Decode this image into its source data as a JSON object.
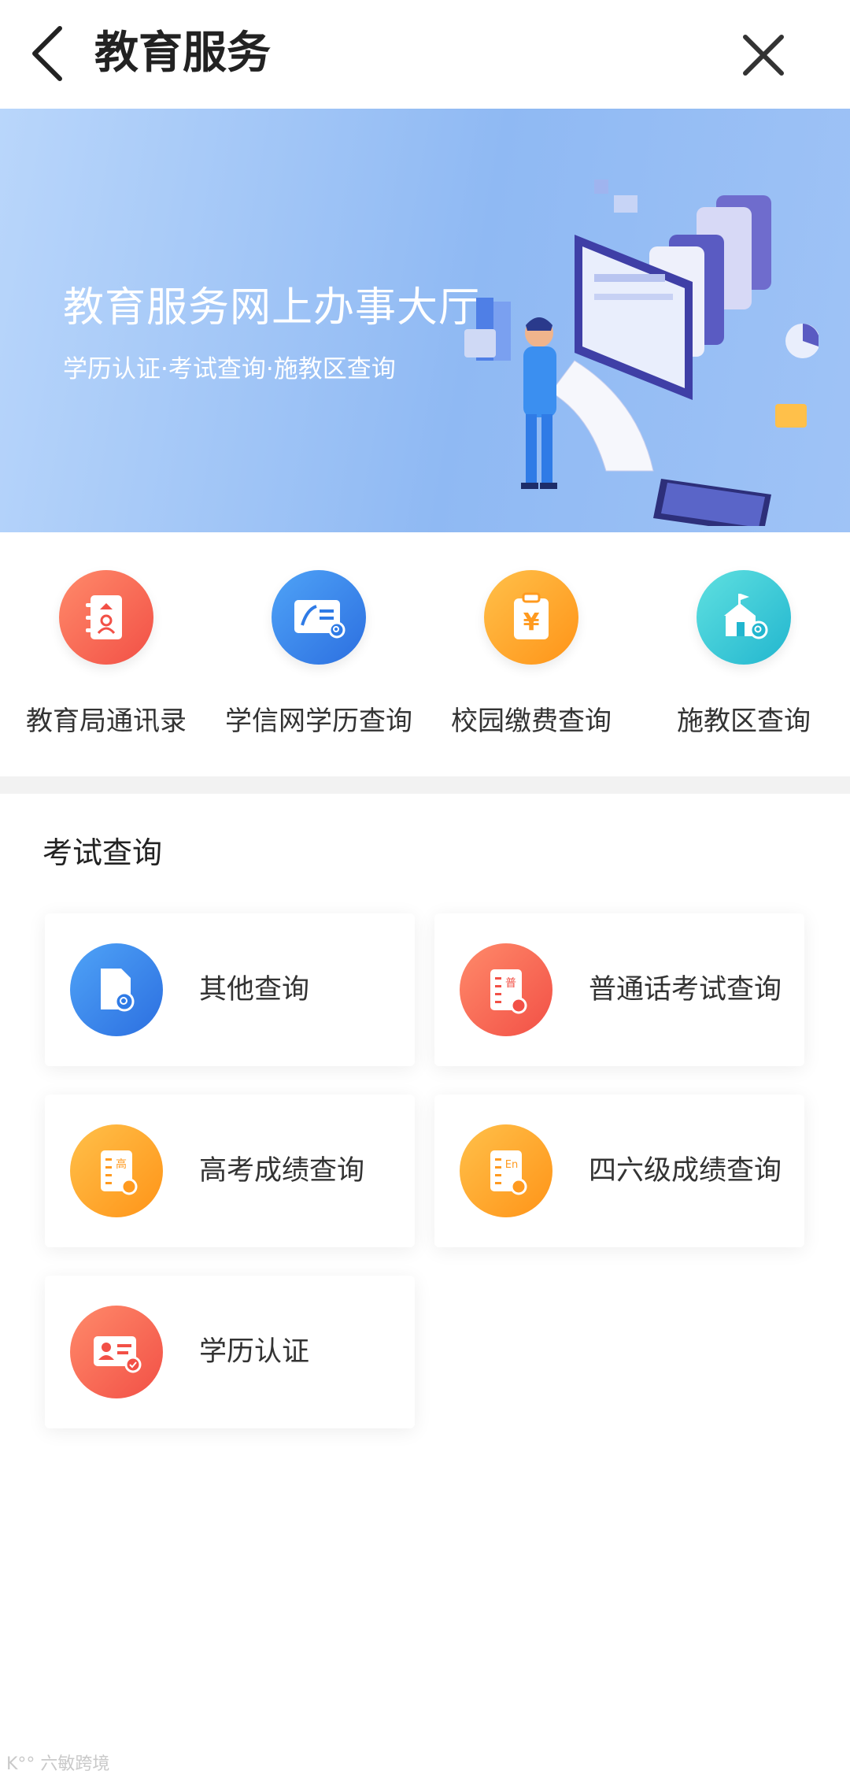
{
  "header": {
    "title": "教育服务"
  },
  "banner": {
    "title": "教育服务网上办事大厅",
    "subtitle": "学历认证·考试查询·施教区查询"
  },
  "quick_services": [
    {
      "label": "教育局通讯录",
      "icon": "contacts-book-icon",
      "color": "#f55a3c"
    },
    {
      "label": "学信网学历查询",
      "icon": "id-card-search-icon",
      "color": "#2f7be6"
    },
    {
      "label": "校园缴费查询",
      "icon": "yuan-clipboard-icon",
      "color": "#ff9a1f"
    },
    {
      "label": "施教区查询",
      "icon": "school-search-icon",
      "color": "#22b8cf"
    }
  ],
  "exam_section": {
    "title": "考试查询",
    "cards": [
      {
        "label": "其他查询",
        "icon": "document-search-icon",
        "color": "#2f7be6"
      },
      {
        "label": "普通话考试查询",
        "icon": "putonghua-document-icon",
        "color": "#f25046",
        "glyph": "普"
      },
      {
        "label": "高考成绩查询",
        "icon": "gaokao-document-icon",
        "color": "#ff9a1f",
        "glyph": "高"
      },
      {
        "label": "四六级成绩查询",
        "icon": "english-document-icon",
        "color": "#ff9a1f",
        "glyph": "En"
      },
      {
        "label": "学历认证",
        "icon": "certificate-icon",
        "color": "#f25046"
      }
    ]
  }
}
